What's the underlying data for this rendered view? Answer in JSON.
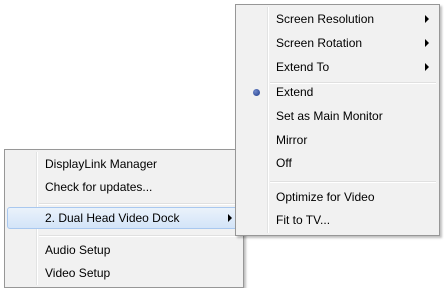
{
  "main_menu": {
    "items": [
      {
        "label": "DisplayLink Manager"
      },
      {
        "label": "Check for updates..."
      },
      {
        "label": "2. Dual Head Video Dock"
      },
      {
        "label": "Audio Setup"
      },
      {
        "label": "Video Setup"
      }
    ]
  },
  "submenu": {
    "items": [
      {
        "label": "Screen Resolution"
      },
      {
        "label": "Screen Rotation"
      },
      {
        "label": "Extend To"
      },
      {
        "label": "Extend",
        "checked": true
      },
      {
        "label": "Set as Main Monitor"
      },
      {
        "label": "Mirror"
      },
      {
        "label": "Off"
      },
      {
        "label": "Optimize for Video"
      },
      {
        "label": "Fit to TV..."
      }
    ]
  },
  "icons": {
    "submenu_arrow": "chevron-right-icon",
    "radio_selected": "radio-bullet-icon"
  },
  "colors": {
    "menu_bg": "#f1f1f1",
    "menu_border": "#979797",
    "hover_border": "#a9c8ef",
    "radio_bullet": "#1f3c8c"
  }
}
